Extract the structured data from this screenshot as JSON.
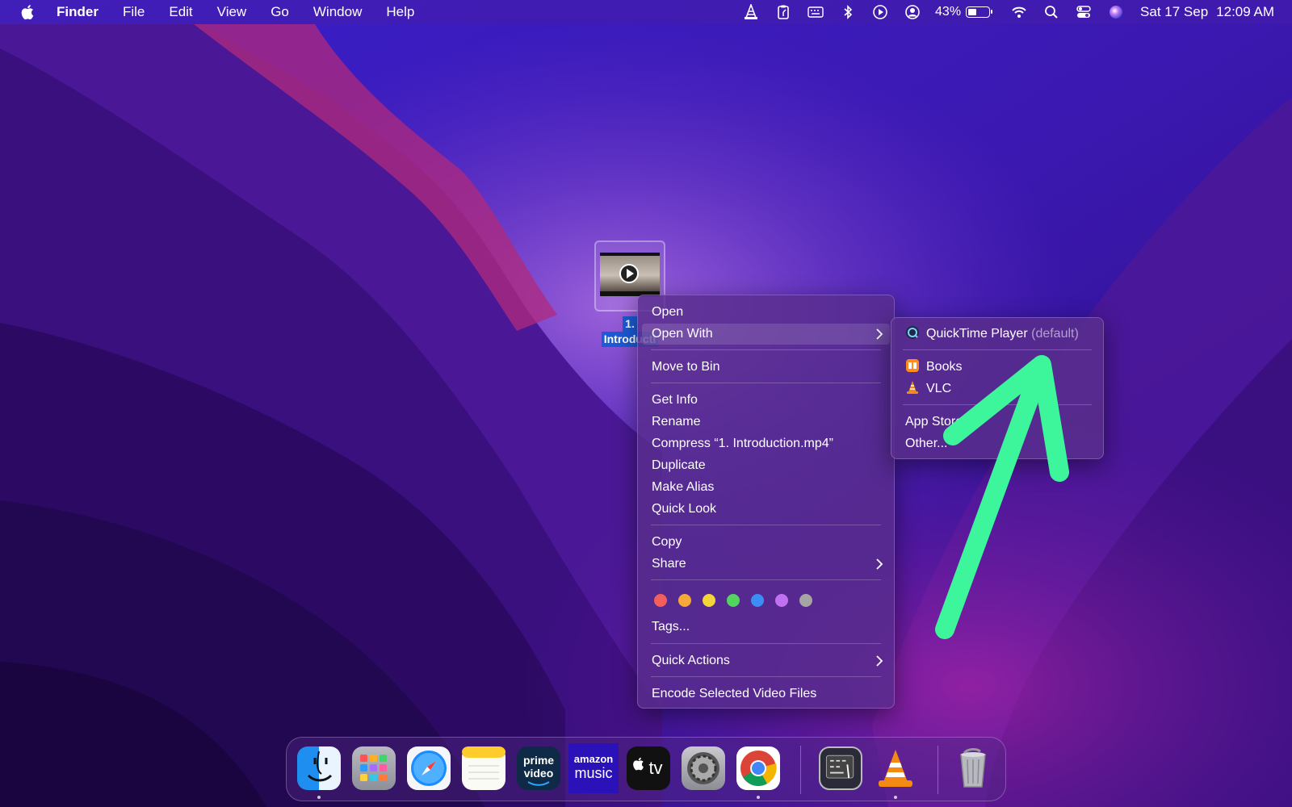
{
  "menubar": {
    "app_name": "Finder",
    "menus": [
      "File",
      "Edit",
      "View",
      "Go",
      "Window",
      "Help"
    ],
    "status_icons": [
      "vlc-cone-icon",
      "clipboard-icon",
      "keyboard-icon",
      "bluetooth-icon",
      "play-circle-icon",
      "user-circle-icon"
    ],
    "battery_percent": "43%",
    "battery_level": 0.43,
    "date": "Sat 17 Sep",
    "time": "12:09 AM"
  },
  "desktop_file": {
    "label_line1": "1.",
    "label_line2": "Introducti"
  },
  "context_menu": {
    "open": "Open",
    "open_with": "Open With",
    "move_to_bin": "Move to Bin",
    "get_info": "Get Info",
    "rename": "Rename",
    "compress": "Compress “1. Introduction.mp4”",
    "duplicate": "Duplicate",
    "make_alias": "Make Alias",
    "quick_look": "Quick Look",
    "copy": "Copy",
    "share": "Share",
    "tags": "Tags...",
    "quick_actions": "Quick Actions",
    "encode": "Encode Selected Video Files",
    "tag_colors": [
      "#f25f5c",
      "#f4a93b",
      "#f4d43b",
      "#52d45e",
      "#3b8ff4",
      "#c070f0",
      "#a5a5a5"
    ]
  },
  "open_with_submenu": {
    "quicktime": "QuickTime Player",
    "quicktime_suffix": "(default)",
    "books": "Books",
    "vlc": "VLC",
    "app_store": "App Store...",
    "other": "Other..."
  },
  "dock": {
    "apps": [
      "finder-icon",
      "launchpad-icon",
      "safari-icon",
      "notes-icon",
      "prime-video-icon",
      "amazon-music-icon",
      "apple-tv-icon",
      "system-preferences-icon",
      "chrome-icon",
      "keyboard-viewer-icon",
      "vlc-icon",
      "trash-icon"
    ],
    "prime_line1": "prime",
    "prime_line2": "video",
    "music_line1": "amazon",
    "music_line2": "music",
    "tv_label": "tv"
  },
  "colors": {
    "annotation_arrow": "#3df59b",
    "selection_blue": "#1c5bd6"
  }
}
